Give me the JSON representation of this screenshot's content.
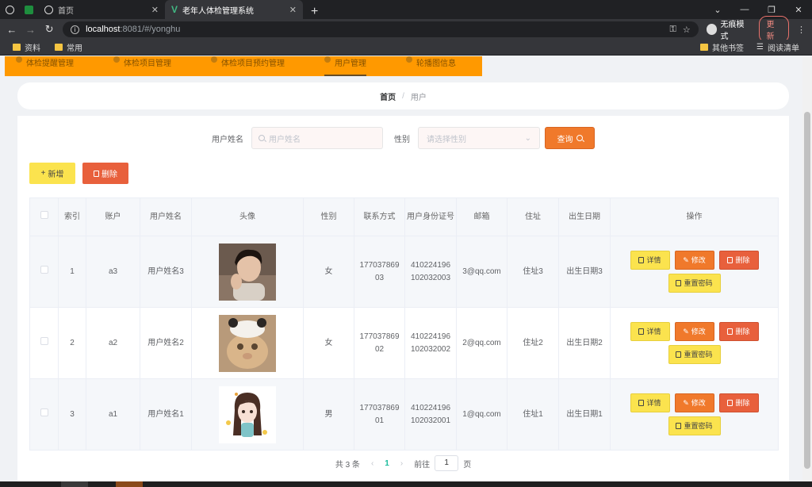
{
  "browser": {
    "tabs": [
      {
        "title": "首页"
      },
      {
        "title": "老年人体检管理系统"
      }
    ],
    "url_host": "localhost",
    "url_path": ":8081/#/yonghu",
    "incognito_label": "无痕模式",
    "update_label": "更新",
    "bookmarks": [
      "资料",
      "常用"
    ],
    "bookmarks_right": [
      "其他书签",
      "阅读清单"
    ]
  },
  "topnav": {
    "items": [
      "体检提醒管理",
      "体检项目管理",
      "体检项目预约管理",
      "用户管理",
      "轮播图信息"
    ]
  },
  "breadcrumb": {
    "home": "首页",
    "sep": "/",
    "current": "用户"
  },
  "search": {
    "name_label": "用户姓名",
    "name_placeholder": "用户姓名",
    "gender_label": "性别",
    "gender_placeholder": "请选择性别",
    "query_label": "查询"
  },
  "actions": {
    "add_label": "新增",
    "delete_label": "删除"
  },
  "table": {
    "headers": [
      "索引",
      "账户",
      "用户姓名",
      "头像",
      "性别",
      "联系方式",
      "用户身份证号",
      "邮箱",
      "住址",
      "出生日期",
      "操作"
    ],
    "rows": [
      {
        "index": "1",
        "account": "a3",
        "name": "用户姓名3",
        "avatar": "boy-photo",
        "gender": "女",
        "phone": "17703786903",
        "idcard": "410224196102032003",
        "email": "3@qq.com",
        "address": "住址3",
        "birth": "出生日期3"
      },
      {
        "index": "2",
        "account": "a2",
        "name": "用户姓名2",
        "avatar": "cat-photo",
        "gender": "女",
        "phone": "17703786902",
        "idcard": "410224196102032002",
        "email": "2@qq.com",
        "address": "住址2",
        "birth": "出生日期2"
      },
      {
        "index": "3",
        "account": "a1",
        "name": "用户姓名1",
        "avatar": "cartoon-girl",
        "gender": "男",
        "phone": "17703786901",
        "idcard": "410224196102032001",
        "email": "1@qq.com",
        "address": "住址1",
        "birth": "出生日期1"
      }
    ],
    "ops": {
      "detail": "详情",
      "edit": "修改",
      "delete": "删除",
      "reset": "重置密码"
    }
  },
  "pager": {
    "total": "共 3 条",
    "prev": "‹",
    "current": "1",
    "next": "›",
    "goto": "前往",
    "goto_value": "1",
    "page_unit": "页"
  }
}
